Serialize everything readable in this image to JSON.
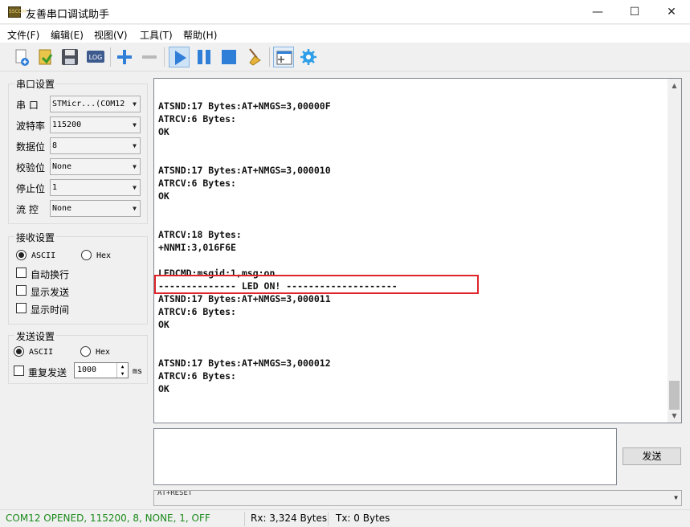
{
  "window": {
    "title": "友善串口调试助手",
    "icon_text": "SSCOM",
    "minimize_glyph": "—",
    "maximize_glyph": "☐",
    "close_glyph": "✕"
  },
  "menu": [
    "文件(F)",
    "编辑(E)",
    "视图(V)",
    "工具(T)",
    "帮助(H)"
  ],
  "toolbar": {
    "buttons": [
      "new-connection-icon",
      "open-folder-icon",
      "save-icon",
      "log-icon",
      "add-icon",
      "remove-icon",
      "play-icon",
      "pause-icon",
      "stop-icon",
      "clear-broom-icon",
      "window-layout-icon",
      "settings-gear-icon"
    ],
    "log_text": "LOG"
  },
  "serial_settings": {
    "title": "串口设置",
    "fields": [
      {
        "label": "串 口",
        "value": "STMicr...(COM12"
      },
      {
        "label": "波特率",
        "value": "115200"
      },
      {
        "label": "数据位",
        "value": "8"
      },
      {
        "label": "校验位",
        "value": "None"
      },
      {
        "label": "停止位",
        "value": "1"
      },
      {
        "label": "流 控",
        "value": "None"
      }
    ]
  },
  "receive_settings": {
    "title": "接收设置",
    "mode_ascii": "ASCII",
    "mode_hex": "Hex",
    "selected_mode": "ASCII",
    "options": [
      {
        "label": "自动换行",
        "checked": false
      },
      {
        "label": "显示发送",
        "checked": false
      },
      {
        "label": "显示时间",
        "checked": false
      }
    ]
  },
  "send_settings": {
    "title": "发送设置",
    "mode_ascii": "ASCII",
    "mode_hex": "Hex",
    "selected_mode": "ASCII",
    "repeat_label": "重复发送",
    "repeat_checked": false,
    "interval_value": "1000",
    "interval_unit": "ms"
  },
  "receive_log": [
    "ATSND:17 Bytes:AT+NMGS=3,00000F",
    "ATRCV:6 Bytes:",
    "OK",
    "",
    "",
    "ATSND:17 Bytes:AT+NMGS=3,000010",
    "ATRCV:6 Bytes:",
    "OK",
    "",
    "",
    "ATRCV:18 Bytes:",
    "+NNMI:3,016F6E",
    "",
    "LEDCMD:msgid:1,msg:on",
    "-------------- LED ON! --------------------",
    "ATSND:17 Bytes:AT+NMGS=3,000011",
    "ATRCV:6 Bytes:",
    "OK",
    "",
    "",
    "ATSND:17 Bytes:AT+NMGS=3,000012",
    "ATRCV:6 Bytes:",
    "OK"
  ],
  "send": {
    "text": "",
    "button_label": "发送",
    "history_value": "AT+RESET"
  },
  "status": {
    "connection": "COM12 OPENED, 115200, 8, NONE, 1, OFF",
    "connection_color": "#1a8a1a",
    "rx": "Rx: 3,324 Bytes",
    "tx": "Tx: 0 Bytes"
  },
  "colors": {
    "accent_blue": "#2f7ed8",
    "highlight_red": "#e0242c"
  }
}
